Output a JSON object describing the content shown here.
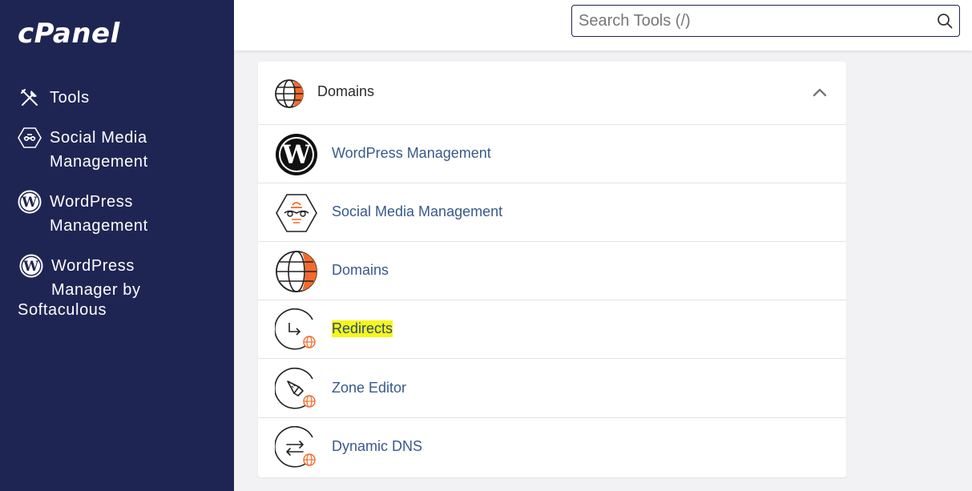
{
  "brand": {
    "logo_text": "cPanel"
  },
  "search": {
    "placeholder": "Search Tools (/)"
  },
  "sidebar": {
    "items": [
      {
        "label": "Tools",
        "icon": "tools-icon"
      },
      {
        "label_line1": "Social Media",
        "label_line2": "Management",
        "icon": "social-media-icon"
      },
      {
        "label_line1": "WordPress",
        "label_line2": "Management",
        "icon": "wordpress-icon"
      },
      {
        "label_line1": "WordPress",
        "label_line2": "Manager by",
        "label_line3": "Softaculous",
        "icon": "wordpress-icon"
      }
    ]
  },
  "section": {
    "title": "Domains",
    "icon": "globe-icon",
    "expanded": true,
    "items": [
      {
        "label": "WordPress Management",
        "icon": "wordpress-icon"
      },
      {
        "label": "Social Media Management",
        "icon": "social-media-icon"
      },
      {
        "label": "Domains",
        "icon": "globe-icon"
      },
      {
        "label": "Redirects",
        "icon": "redirect-icon",
        "highlighted": true
      },
      {
        "label": "Zone Editor",
        "icon": "zone-editor-icon"
      },
      {
        "label": "Dynamic DNS",
        "icon": "dynamic-dns-icon"
      }
    ]
  },
  "colors": {
    "sidebar_bg": "#1f2553",
    "accent_orange": "#f26b2b",
    "link_blue": "#375a8c",
    "highlight": "#f6f51c"
  }
}
